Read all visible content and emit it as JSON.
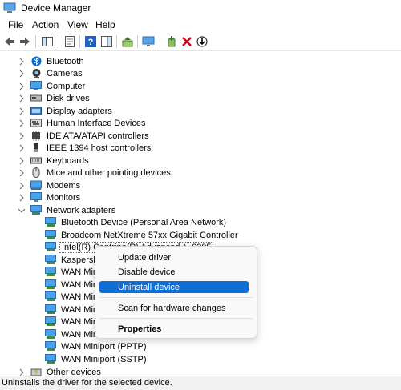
{
  "window": {
    "title": "Device Manager",
    "app_icon": "device-manager-icon"
  },
  "menu": [
    "File",
    "Action",
    "View",
    "Help"
  ],
  "toolbar": [
    {
      "name": "back-icon"
    },
    {
      "name": "forward-icon"
    },
    {
      "name": "show-hide-console-tree-icon"
    },
    {
      "name": "properties-icon"
    },
    {
      "name": "help-icon"
    },
    {
      "name": "show-action-pane-icon"
    },
    {
      "name": "update-driver-icon"
    },
    {
      "name": "scan-hardware-icon"
    },
    {
      "name": "add-driver-icon"
    },
    {
      "name": "uninstall-icon"
    },
    {
      "name": "disable-device-icon"
    }
  ],
  "tree": {
    "categories_top": [
      {
        "label": "Bluetooth",
        "icon": "bluetooth-icon"
      },
      {
        "label": "Cameras",
        "icon": "camera-icon"
      },
      {
        "label": "Computer",
        "icon": "computer-icon"
      },
      {
        "label": "Disk drives",
        "icon": "disk-icon"
      },
      {
        "label": "Display adapters",
        "icon": "display-icon"
      },
      {
        "label": "Human Interface Devices",
        "icon": "hid-icon"
      },
      {
        "label": "IDE ATA/ATAPI controllers",
        "icon": "ide-icon"
      },
      {
        "label": "IEEE 1394 host controllers",
        "icon": "ieee1394-icon"
      },
      {
        "label": "Keyboards",
        "icon": "keyboard-icon"
      },
      {
        "label": "Mice and other pointing devices",
        "icon": "mouse-icon"
      },
      {
        "label": "Modems",
        "icon": "modem-icon"
      },
      {
        "label": "Monitors",
        "icon": "monitor-icon"
      }
    ],
    "expanded_category": {
      "label": "Network adapters",
      "icon": "network-icon"
    },
    "network_children": [
      "Bluetooth Device (Personal Area Network)",
      "Broadcom NetXtreme 57xx Gigabit Controller",
      "Intel(R) Centrino(R) Advanced-N 6205",
      "Kaspersky",
      "WAN Mini",
      "WAN Mini",
      "WAN Mini",
      "WAN Mini",
      "WAN Mini",
      "WAN Mini",
      "WAN Miniport (PPTP)",
      "WAN Miniport (SSTP)"
    ],
    "after": {
      "label": "Other devices",
      "icon": "other-devices-icon"
    }
  },
  "context_menu": {
    "items": [
      "Update driver",
      "Disable device",
      "Uninstall device",
      "Scan for hardware changes",
      "Properties"
    ],
    "highlighted": "Uninstall device",
    "default": "Properties"
  },
  "status": "Uninstalls the driver for the selected device."
}
